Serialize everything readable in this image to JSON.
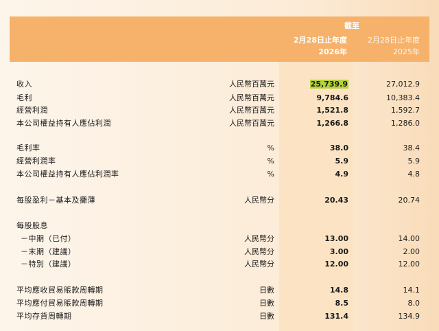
{
  "header": {
    "as_of": "截至",
    "cur_period": "2月28日止年度",
    "cur_year": "2026年",
    "prev_period": "2月28日止年度",
    "prev_year": "2025年"
  },
  "rows": {
    "revenue": {
      "label": "收入",
      "unit": "人民幣百萬元",
      "cur": "25,739.9",
      "prev": "27,012.9"
    },
    "gross_profit": {
      "label": "毛利",
      "unit": "人民幣百萬元",
      "cur": "9,784.6",
      "prev": "10,383.4"
    },
    "operating_profit": {
      "label": "經營利潤",
      "unit": "人民幣百萬元",
      "cur": "1,521.8",
      "prev": "1,592.7"
    },
    "attributable_profit": {
      "label": "本公司權益持有人應佔利潤",
      "unit": "人民幣百萬元",
      "cur": "1,266.8",
      "prev": "1,286.0"
    },
    "gross_margin": {
      "label": "毛利率",
      "unit": "%",
      "cur": "38.0",
      "prev": "38.4"
    },
    "operating_margin": {
      "label": "經營利潤率",
      "unit": "%",
      "cur": "5.9",
      "prev": "5.9"
    },
    "attributable_margin": {
      "label": "本公司權益持有人應佔利潤率",
      "unit": "%",
      "cur": "4.9",
      "prev": "4.8"
    },
    "eps": {
      "label": "每股盈利－基本及攤薄",
      "unit": "人民幣分",
      "cur": "20.43",
      "prev": "20.74"
    },
    "dps_title": {
      "label": "每股股息"
    },
    "dps_interim": {
      "label": "－中期（已付）",
      "unit": "人民幣分",
      "cur": "13.00",
      "prev": "14.00"
    },
    "dps_final": {
      "label": "－末期（建議）",
      "unit": "人民幣分",
      "cur": "3.00",
      "prev": "2.00"
    },
    "dps_special": {
      "label": "－特別（建議）",
      "unit": "人民幣分",
      "cur": "12.00",
      "prev": "12.00"
    },
    "receivable_turnover": {
      "label": "平均應收貿易賬款周轉期",
      "unit": "日數",
      "cur": "14.8",
      "prev": "14.1"
    },
    "payable_turnover": {
      "label": "平均應付貿易賬款周轉期",
      "unit": "日數",
      "cur": "8.5",
      "prev": "8.0"
    },
    "inventory_turnover": {
      "label": "平均存貨周轉期",
      "unit": "日數",
      "cur": "131.4",
      "prev": "134.9"
    }
  },
  "colors": {
    "header_bg": "#f6b26b",
    "highlight_column": "#fbe3c4",
    "text_marker": "#b6d33a"
  }
}
